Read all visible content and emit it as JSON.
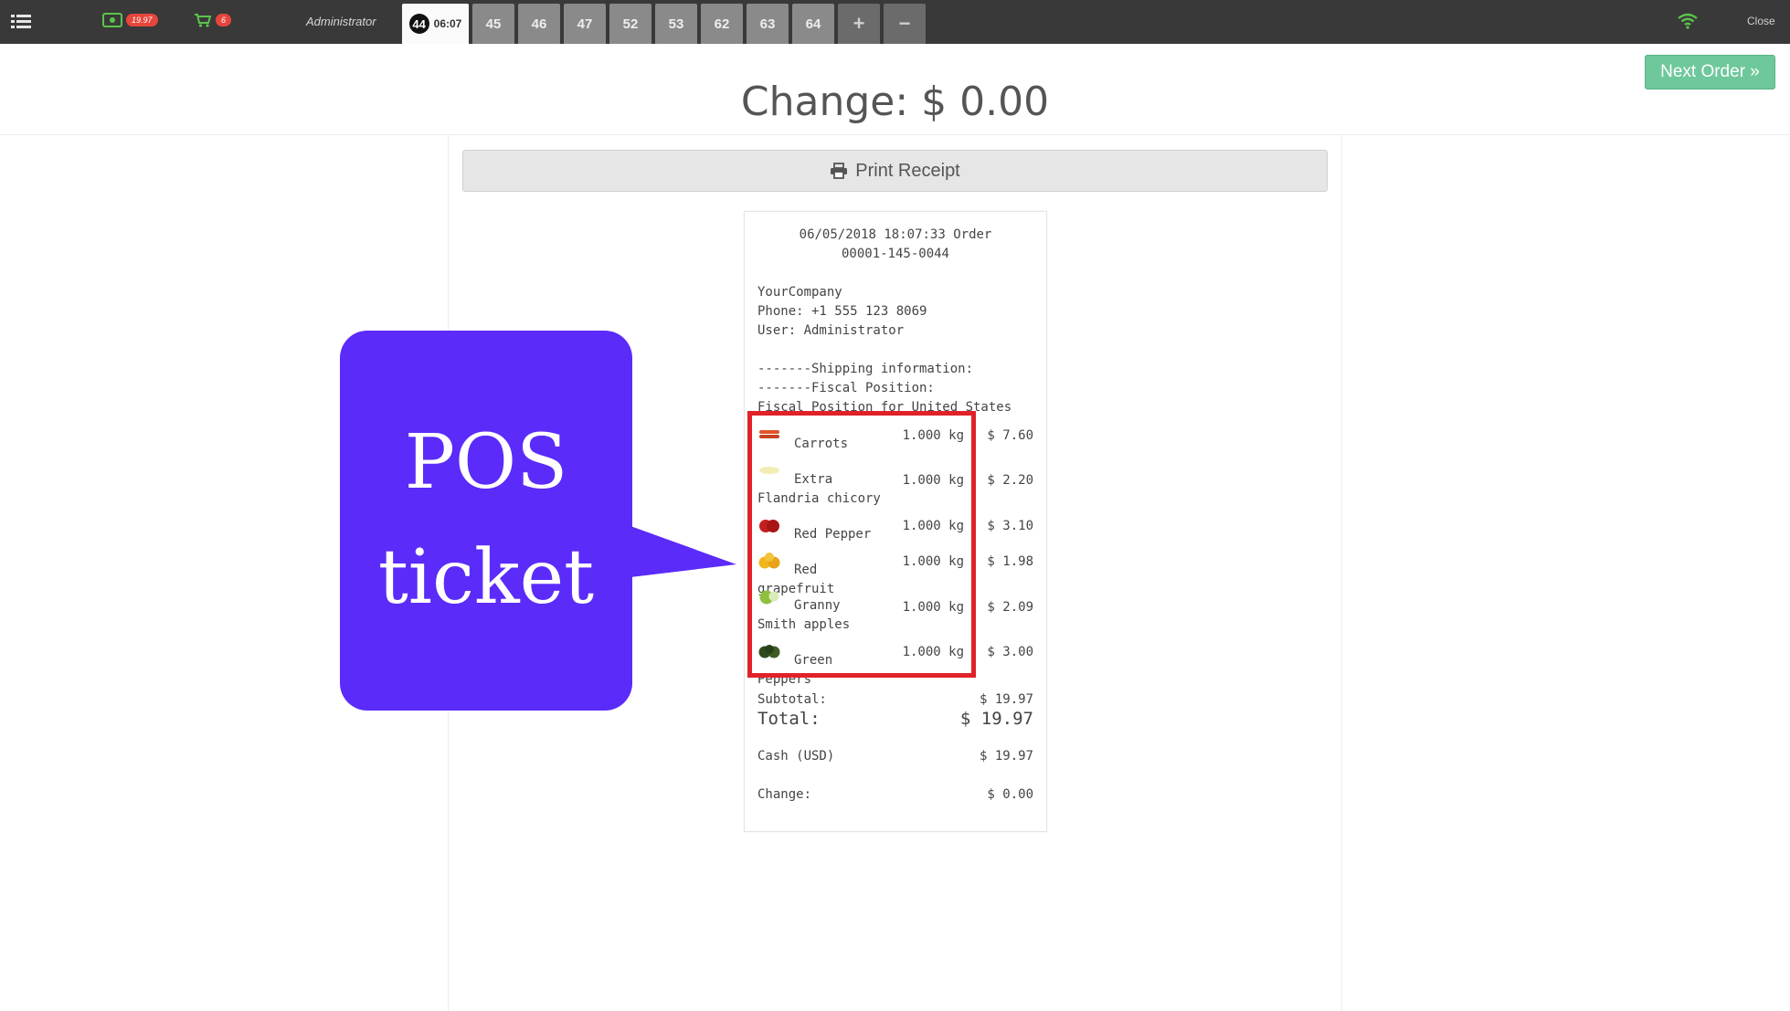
{
  "topbar": {
    "cash_amount": "19.97",
    "cart_count": "6",
    "user": "Administrator",
    "active_order": {
      "seq": "44",
      "time": "06:07"
    },
    "orders": [
      "45",
      "46",
      "47",
      "52",
      "53",
      "62",
      "63",
      "64"
    ],
    "add_symbol": "+",
    "remove_symbol": "−",
    "close_label": "Close"
  },
  "screen": {
    "change_label": "Change: $ 0.00",
    "next_order_label": "Next Order »",
    "print_label": "Print Receipt"
  },
  "receipt": {
    "header_line1": "06/05/2018 18:07:33 Order",
    "header_line2": "00001-145-0044",
    "company": "YourCompany",
    "phone": "Phone: +1 555 123 8069",
    "user": "User: Administrator",
    "shipping": "-------Shipping information:",
    "fiscal": "-------Fiscal Position:",
    "fiscal_name": "Fiscal Position for United States",
    "lines": [
      {
        "name": "Carrots",
        "qty": "1.000 kg",
        "price": "$ 7.60",
        "icon": "carrot-icon"
      },
      {
        "name": "Extra Flandria chicory",
        "qty": "1.000 kg",
        "price": "$ 2.20",
        "icon": "chicory-icon"
      },
      {
        "name": "Red Pepper",
        "qty": "1.000 kg",
        "price": "$ 3.10",
        "icon": "red-pepper-icon"
      },
      {
        "name": "Red grapefruit",
        "qty": "1.000 kg",
        "price": "$ 1.98",
        "icon": "grapefruit-icon"
      },
      {
        "name": "Granny Smith apples",
        "qty": "1.000 kg",
        "price": "$ 2.09",
        "icon": "apple-icon"
      },
      {
        "name": "Green Peppers",
        "qty": "1.000 kg",
        "price": "$ 3.00",
        "icon": "green-pepper-icon"
      }
    ],
    "subtotal_label": "Subtotal:",
    "subtotal_value": "$ 19.97",
    "total_label": "Total:",
    "total_value": "$ 19.97",
    "cash_label": "Cash (USD)",
    "cash_value": "$ 19.97",
    "change_label": "Change:",
    "change_value": "$ 0.00"
  },
  "callout": {
    "line1": "POS",
    "line2": "ticket"
  },
  "colors": {
    "topbar": "#393939",
    "accent_green": "#6ec89b",
    "callout": "#5b2bfa",
    "highlight": "#e02228",
    "badge": "#e8453c"
  }
}
